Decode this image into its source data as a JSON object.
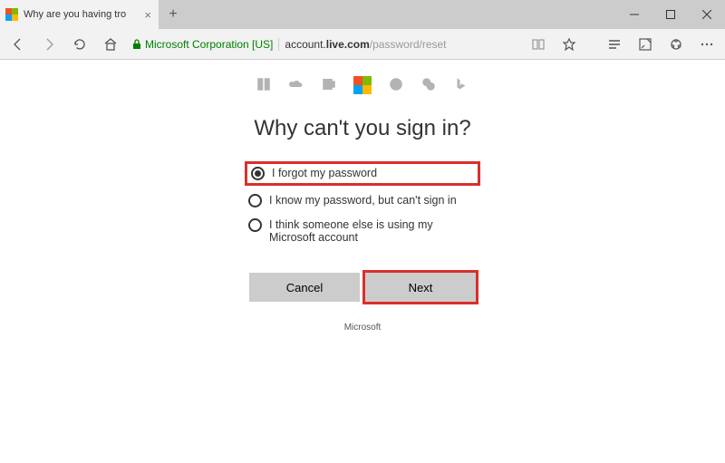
{
  "titlebar": {
    "tab_title": "Why are you having tro"
  },
  "toolbar": {
    "cert_name": "Microsoft Corporation [US]",
    "url_host": "account.live.com",
    "url_path": "/password/reset"
  },
  "page": {
    "heading": "Why can't you sign in?",
    "options": [
      "I forgot my password",
      "I know my password, but can't sign in",
      "I think someone else is using my Microsoft account"
    ],
    "cancel": "Cancel",
    "next": "Next",
    "footer": "Microsoft"
  },
  "colors": {
    "ms_red": "#f25022",
    "ms_green": "#7fba00",
    "ms_blue": "#00a4ef",
    "ms_yellow": "#ffb900"
  }
}
